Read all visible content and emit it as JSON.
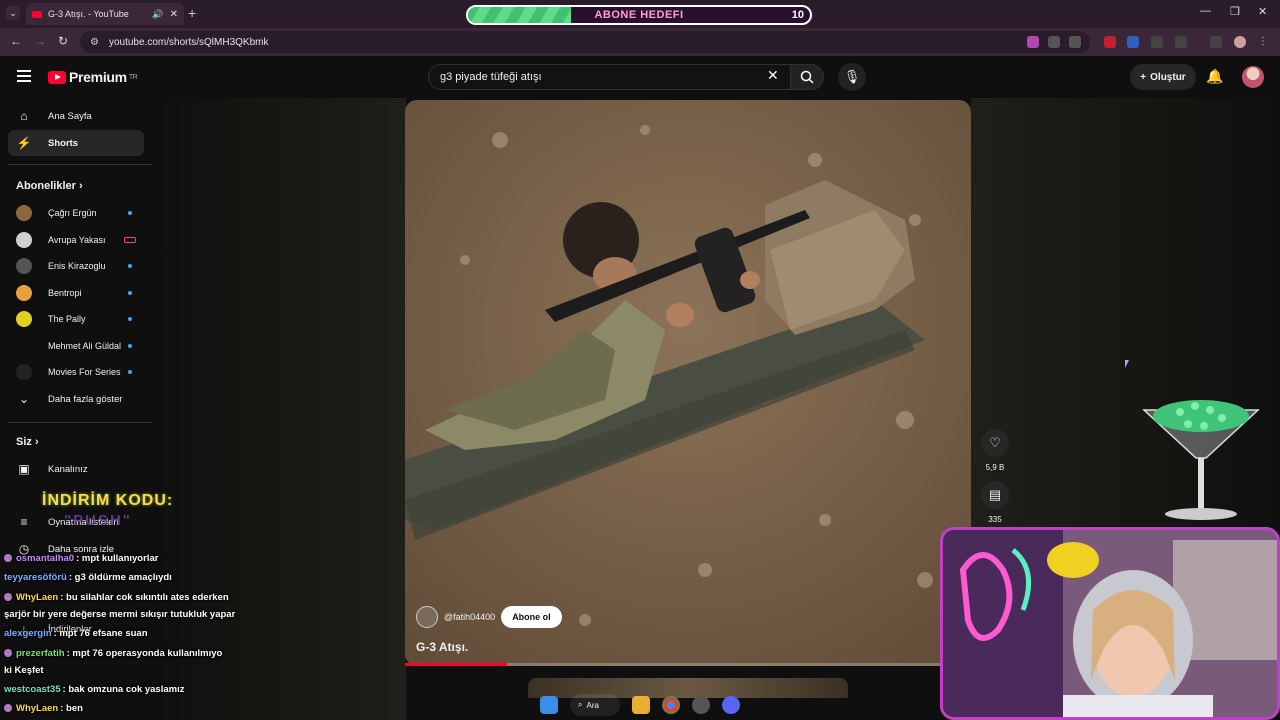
{
  "browser": {
    "tab_title": "G-3 Atışı. - YouTube",
    "url": "youtube.com/shorts/sQlMH3QKbmk"
  },
  "overlay_goal": {
    "label": "ABONE HEDEFI",
    "count": "10",
    "progress": 0.3
  },
  "header": {
    "logo": "Premium",
    "region": "TR",
    "search_value": "g3 piyade tüfeği atışı",
    "create_label": "Oluştur"
  },
  "sidebar": {
    "main": [
      {
        "label": "Ana Sayfa",
        "icon": "home-icon"
      },
      {
        "label": "Shorts",
        "icon": "shorts-icon"
      }
    ],
    "subs_title": "Abonelikler",
    "subscriptions": [
      {
        "label": "Çağrı Ergün",
        "color": "#8a6a3a",
        "status": "dot"
      },
      {
        "label": "Avrupa Yakası",
        "color": "#cfcfcf",
        "status": "live"
      },
      {
        "label": "Enis Kirazoglu",
        "color": "#555555",
        "status": "dot"
      },
      {
        "label": "Bentropi",
        "color": "#e8a040",
        "status": "dot"
      },
      {
        "label": "The Pally",
        "color": "#e0d020",
        "status": "dot"
      },
      {
        "label": "Mehmet Ali Güldal",
        "color": "#0f0f0f",
        "status": "dot"
      },
      {
        "label": "Movies For Series",
        "color": "#222222",
        "status": "dot"
      }
    ],
    "show_more": "Daha fazla göster",
    "you_title": "Siz",
    "you_items": [
      {
        "label": "Kanalınız",
        "icon": "user-box-icon"
      },
      {
        "label": "Oynatma listeleri",
        "icon": "playlist-icon"
      },
      {
        "label": "Daha sonra izle",
        "icon": "clock-icon"
      },
      {
        "label": "İndirilenler",
        "icon": "download-icon"
      }
    ]
  },
  "video": {
    "channel": "@fatih04400",
    "subscribe": "Abone ol",
    "title": "G-3 Atışı.",
    "progress": 0.18,
    "likes": "5,9 B",
    "comments": "335"
  },
  "overlay": {
    "promo": "İNDİRİM KODU:",
    "promo_code": "\"PUSH\""
  },
  "chat": [
    {
      "user": "osmantalha0",
      "text": ": mpt kullanıyorlar",
      "color": "#c48aff",
      "badge": true
    },
    {
      "user": "teyyaresöförü",
      "text": ": g3 öldürme amaçlıydı",
      "color": "#7bb0ff",
      "badge": false
    },
    {
      "user": "WhyLaen",
      "text": ": bu silahlar cok sıkıntılı ates ederken",
      "color": "#ffd84a",
      "badge": true
    },
    {
      "user": "",
      "text": "şarjör bir yere değerse mermi sıkışır tutukluk yapar",
      "color": "#ffffff",
      "badge": false
    },
    {
      "user": "alexgergin",
      "text": ": mpt 76 efsane suan",
      "color": "#7bb0ff",
      "badge": false
    },
    {
      "user": "prezerfatih",
      "text": ": mpt 76 operasyonda kullanılmıyo",
      "color": "#7be07b",
      "badge": true
    },
    {
      "user": "",
      "text": "ki Keşfet",
      "color": "#ffffff",
      "badge": false
    },
    {
      "user": "westcoast35",
      "text": ": bak omzuna cok yaslamız",
      "color": "#7be0c0",
      "badge": false
    },
    {
      "user": "WhyLaen",
      "text": ": ben",
      "color": "#ffd84a",
      "badge": true
    }
  ],
  "taskbar": {
    "search_label": "Ara"
  }
}
